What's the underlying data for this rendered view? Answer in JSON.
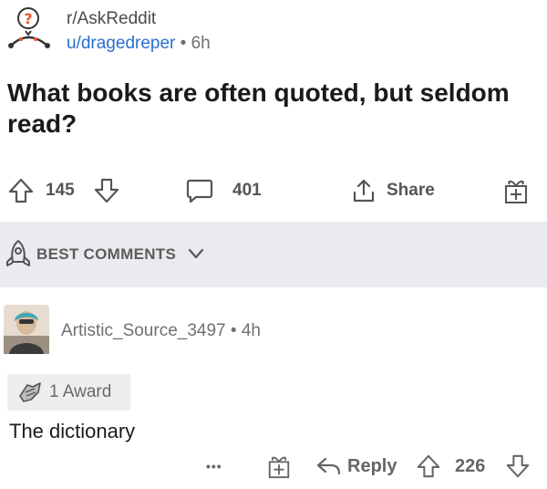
{
  "post": {
    "subreddit": "r/AskReddit",
    "username": "u/dragedreper",
    "separator": "•",
    "age": "6h",
    "title": "What books are often quoted, but seldom read?"
  },
  "actions": {
    "upvotes": "145",
    "comments": "401",
    "share_label": "Share"
  },
  "sort": {
    "label": "BEST COMMENTS"
  },
  "comment": {
    "author": "Artistic_Source_3497",
    "separator": "•",
    "age": "4h",
    "award_label": "1 Award",
    "body": "The dictionary",
    "more": "•••",
    "reply_label": "Reply",
    "score": "226"
  },
  "colors": {
    "link_blue": "#2a6fd1",
    "sort_bar_bg": "#e9ebee",
    "icon_gray": "#555555",
    "snoo_orange": "#e8552b"
  }
}
